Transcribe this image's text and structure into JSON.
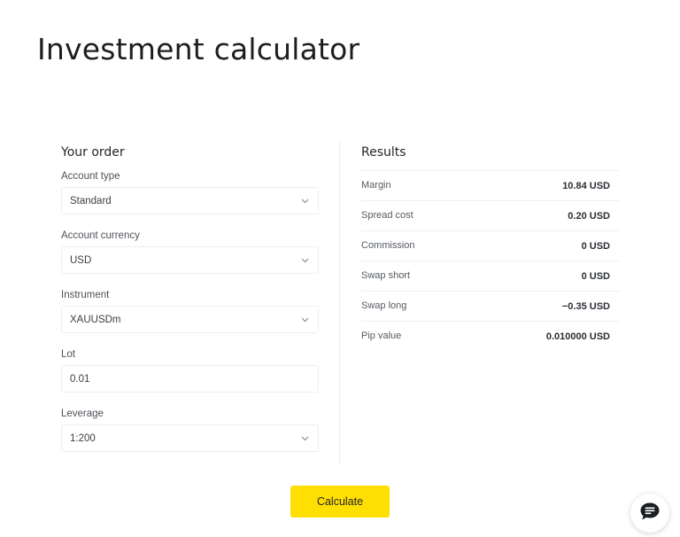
{
  "page": {
    "title": "Investment calculator"
  },
  "order": {
    "title": "Your order",
    "fields": {
      "account_type": {
        "label": "Account type",
        "value": "Standard"
      },
      "account_currency": {
        "label": "Account currency",
        "value": "USD"
      },
      "instrument": {
        "label": "Instrument",
        "value": "XAUUSDm"
      },
      "lot": {
        "label": "Lot",
        "value": "0.01"
      },
      "leverage": {
        "label": "Leverage",
        "value": "1:200"
      }
    }
  },
  "results": {
    "title": "Results",
    "rows": [
      {
        "label": "Margin",
        "value": "10.84 USD"
      },
      {
        "label": "Spread cost",
        "value": "0.20 USD"
      },
      {
        "label": "Commission",
        "value": "0 USD"
      },
      {
        "label": "Swap short",
        "value": "0 USD"
      },
      {
        "label": "Swap long",
        "value": "−0.35 USD"
      },
      {
        "label": "Pip value",
        "value": "0.010000 USD"
      }
    ]
  },
  "actions": {
    "calculate_label": "Calculate"
  },
  "icons": {
    "chevron": "chevron-down-icon",
    "chat": "chat-bubble-icon"
  },
  "colors": {
    "accent_button": "#ffde02",
    "chat_icon": "#1b1e21"
  }
}
